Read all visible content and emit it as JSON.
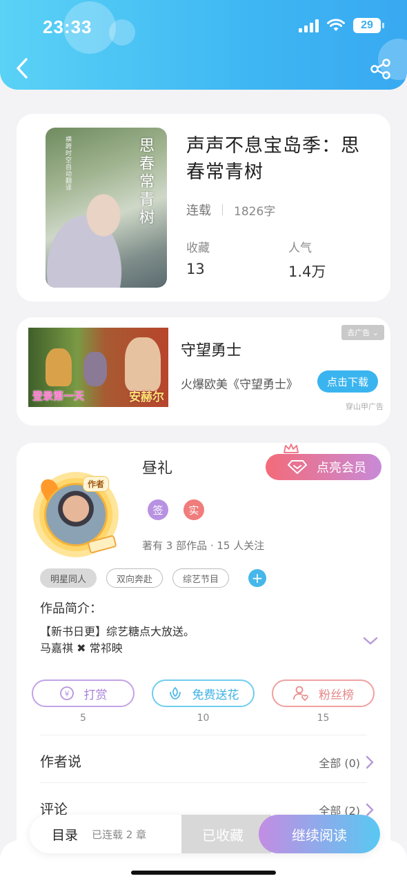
{
  "status_bar": {
    "time": "23:33",
    "battery": "29"
  },
  "book": {
    "title": "声声不息宝岛季：思春常青树",
    "status": "连载",
    "word_count": "1826字",
    "cover_title": "思春常青树",
    "cover_subtitle": "横跨时空自动翻译",
    "favorites_label": "收藏",
    "favorites_value": "13",
    "popularity_label": "人气",
    "popularity_value": "1.4万"
  },
  "ad": {
    "title": "守望勇士",
    "description": "火爆欧美《守望勇士》",
    "close_label": "去广告",
    "download_label": "点击下载",
    "source": "穿山甲广告",
    "image_text_left": "登录第一天",
    "image_text_right": "安赫尔"
  },
  "author": {
    "name": "昼礼",
    "tag": "作者",
    "vip_label": "点亮会员",
    "badge_sign": "签",
    "badge_real": "实",
    "info": "著有 3 部作品 · 15 人关注",
    "tags": [
      "明星同人",
      "双向奔赴",
      "综艺节目"
    ],
    "intro_label": "作品简介：",
    "intro_line1": "【新书日更】综艺糖点大放送。",
    "intro_line2": "马嘉祺 ✖ 常祁映"
  },
  "actions": {
    "reward_label": "打赏",
    "reward_count": "5",
    "flower_label": "免费送花",
    "flower_count": "10",
    "fans_label": "粉丝榜",
    "fans_count": "15"
  },
  "sections": {
    "author_says": "作者说",
    "author_says_count": "全部 (0)",
    "comments": "评论",
    "comments_count": "全部 (2)"
  },
  "bottom_bar": {
    "toc": "目录",
    "chapters": "已连载 2 章",
    "favorited": "已收藏",
    "continue": "继续阅读"
  },
  "colors": {
    "header": "#3fb7f3",
    "accent_blue": "#45b7ea",
    "reward_purple": "#b88ee0",
    "flower_blue": "#57c6ec",
    "fans_red": "#ee8a8a"
  }
}
